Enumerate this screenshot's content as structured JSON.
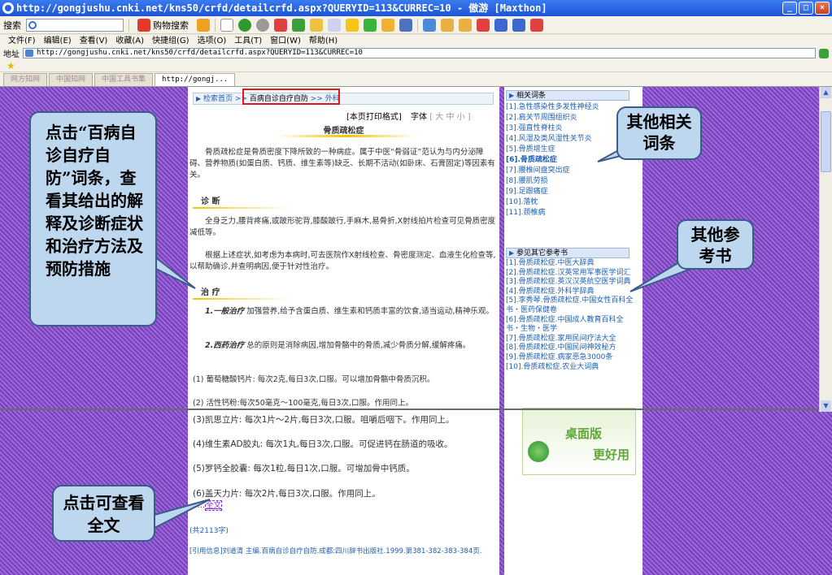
{
  "window": {
    "title": "http://gongjushu.cnki.net/kns50/crfd/detailcrfd.aspx?QUERYID=113&CURREC=10 - 傲游 [Maxthon]",
    "min": "_",
    "max": "□",
    "close": "×"
  },
  "toolbar": {
    "search_label": "搜索",
    "shopping_label": "购物搜索"
  },
  "menu": [
    "文件(F)",
    "编辑(E)",
    "查看(V)",
    "收藏(A)",
    "快捷组(G)",
    "选项(O)",
    "工具(T)",
    "窗口(W)",
    "帮助(H)"
  ],
  "address": {
    "label": "地址",
    "url": "http://gongjushu.cnki.net/kns50/crfd/detailcrfd.aspx?QUERYID=113&CURREC=10"
  },
  "tabs": [
    "网方知网",
    "中国知网",
    "中国工具书集",
    "http://gongj..."
  ],
  "breadcrumb": {
    "home": "检索首页",
    "sep1": " >> ",
    "book": "百病自诊自疗自防",
    "sep2": " >> ",
    "category": "外科"
  },
  "print_row": {
    "print": "[本页打印格式]",
    "font_label": "字体",
    "font_sizes": "[ 大 中 小 ]"
  },
  "article": {
    "title": "骨质疏松症",
    "intro": "骨质疏松症是骨质密度下降所致的一种病症。属于中医“骨弱证”范认为与内分泌障碍、营养物质(如蛋白质、钙质、维生素等)缺乏、长期不活动(如卧床、石膏固定)等因素有关。",
    "diagnosis_title": "诊 断",
    "diagnosis_p1": "全身乏力,腰背疼痛,或跛形驼背,膝酸跛行,手麻木,易骨折,X射线拍片检查可见骨质密度减低等。",
    "diagnosis_p2": "根据上述症状,如考虑为本病时,可去医院作X射线检查、骨密度测定、血液生化检查等,以帮助确诊,并查明病因,便于针对性治疗。",
    "treatment_title": "治 疗",
    "general_label": "1.一般治疗",
    "general_text": " 加强营养,给予含蛋白质、维生素和钙质丰富的饮食,适当运动,精神乐观。",
    "drug_label": "2.西药治疗",
    "drug_text": " 总的原则是消除病因,增加骨骼中的骨质,减少骨质分解,缓解疼痛。",
    "drugs": [
      "(1) 葡萄糖酸钙片: 每次2克,每日3次,口服。可以增加骨骼中骨质沉积。",
      "(2) 活性钙粉:每次50毫克～100毫克,每日3次,口服。作用同上。",
      "(3)凯思立片: 每次1片～2片,每日3次,口服。咀嚼后咽下。作用同上。",
      "(4)维生素AD胶丸: 每次1丸,每日3次,口服。可促进钙在肠道的吸收。",
      "(5)罗钙全胶囊: 每次1粒,每日1次,口服。可增加骨中钙质。",
      "(6)盖天力片: 每次2片,每日3次,口服。作用同上。"
    ],
    "fulltext_prefix": "……",
    "fulltext_link": "全文",
    "word_count": "(共2113字)",
    "citation": "[引用信息]刘道清 主编.百病自诊自疗自防.成都:四川辞书出版社.1999.第381-382-383-384页."
  },
  "side": {
    "related_title": "相关词条",
    "related": [
      "[1].急性感染性多发性神经炎",
      "[2].肩关节周围组织炎",
      "[3].强直性脊柱炎",
      "[4].风湿及类风湿性关节炎",
      "[5].骨质增生症",
      "[6].骨质疏松症",
      "[7].腰椎间盘突出症",
      "[8].腰肌劳损",
      "[9].足跟痛症",
      "[10].落枕",
      "[11].颈椎病"
    ],
    "refs_title": "参见其它参考书",
    "refs": [
      "[1].骨质疏松症.中医大辞典",
      "[2].骨质疏松症.汉英常用军事医学词汇",
      "[3].骨质疏松症.英汉汉英航空医学词典",
      "[4].骨质疏松症.外科学辞典",
      "[5].李秀琴.骨质疏松症.中国女性百科全书・医药保健卷",
      "[6].骨质疏松症.中国成人教育百科全书・生物・医学",
      "[7].骨质疏松症.家用民间疗法大全",
      "[8].骨质疏松症.中国民间神效秘方",
      "[9].骨质疏松症.病家恶急3000条",
      "[10].骨质疏松症.农业大词典"
    ],
    "ad_line1": "桌面版",
    "ad_line2": "更好用"
  },
  "callouts": {
    "left": "点击“百病自诊自疗自防”词条，查看其给出的解释及诊断症状和治疗方法及预防措施",
    "terms": "其他相关词条",
    "books": "其他参考书",
    "fulltext": "点击可查看全文"
  },
  "colors": {
    "callout_bg": "#bdd7ee",
    "link": "#1c5fb5",
    "highlight_box": "#e01818",
    "background": "#7a3fbf"
  }
}
